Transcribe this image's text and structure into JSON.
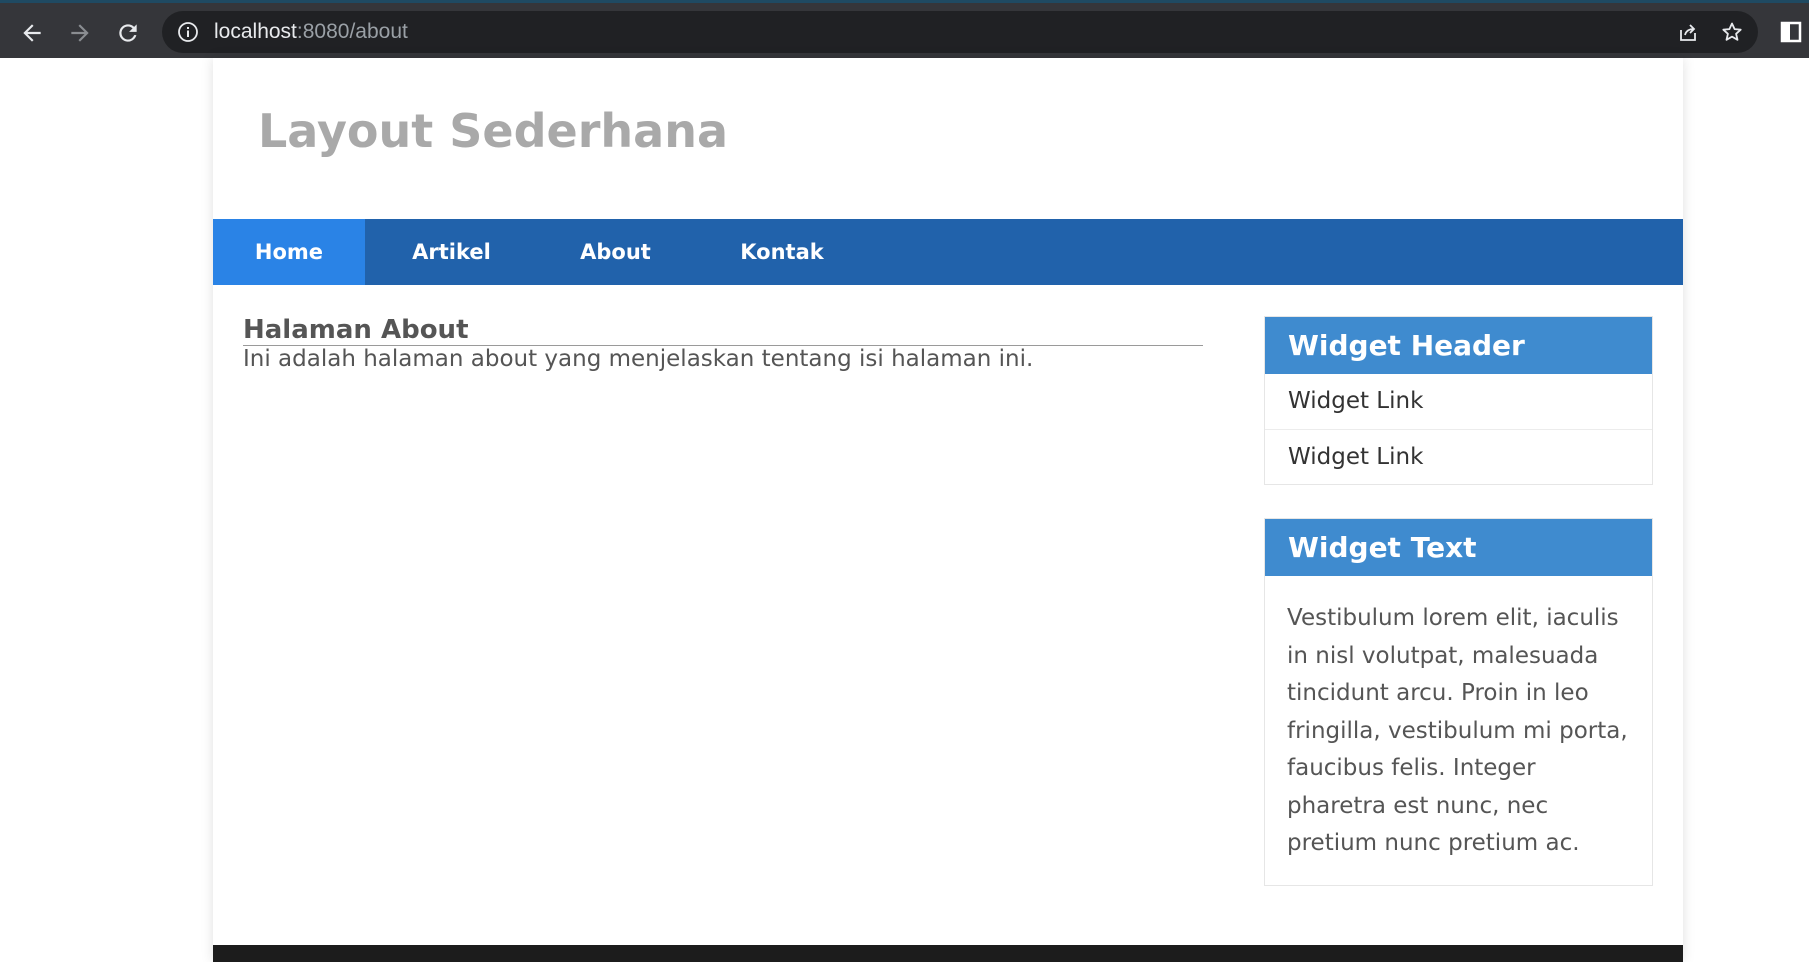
{
  "browser": {
    "url_host": "localhost",
    "url_path": ":8080/about"
  },
  "site": {
    "title": "Layout Sederhana"
  },
  "nav": {
    "items": [
      {
        "label": "Home",
        "active": true
      },
      {
        "label": "Artikel",
        "active": false
      },
      {
        "label": "About",
        "active": false
      },
      {
        "label": "Kontak",
        "active": false
      }
    ]
  },
  "main": {
    "heading": "Halaman About",
    "body": "Ini adalah halaman about yang menjelaskan tentang isi halaman ini."
  },
  "sidebar": {
    "widget_links": {
      "header": "Widget Header",
      "links": [
        "Widget Link",
        "Widget Link"
      ]
    },
    "widget_text": {
      "header": "Widget Text",
      "body": "Vestibulum lorem elit, iaculis in nisl volutpat, malesuada tincidunt arcu. Proin in leo fringilla, vestibulum mi porta, faucibus felis. Integer pharetra est nunc, nec pretium nunc pretium ac."
    }
  },
  "colors": {
    "nav_bg": "#2162ab",
    "nav_active": "#2a83e6",
    "widget_header_bg": "#3f8bcf",
    "title_text": "#a9a9a9",
    "body_text": "#555555"
  }
}
